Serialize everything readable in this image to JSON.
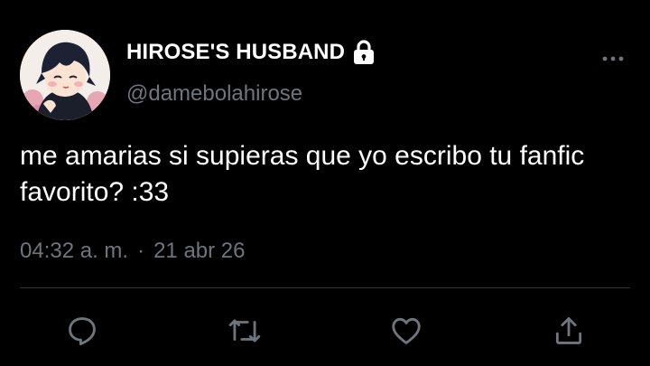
{
  "user": {
    "display_name": "HIROSE'S HUSBAND",
    "handle": "@damebolahirose",
    "protected_icon": "lock-icon"
  },
  "tweet": {
    "text": "me amarias si supieras que yo escribo tu fanfic favorito? :33",
    "time": "04:32 a. m.",
    "separator": "·",
    "date": "21 abr 26"
  },
  "actions": [
    {
      "icon": "reply-icon"
    },
    {
      "icon": "retweet-icon"
    },
    {
      "icon": "like-icon"
    },
    {
      "icon": "share-icon"
    }
  ],
  "colors": {
    "background": "#000000",
    "text_primary": "#ffffff",
    "text_secondary": "#6e767d",
    "divider": "#2f3336"
  }
}
